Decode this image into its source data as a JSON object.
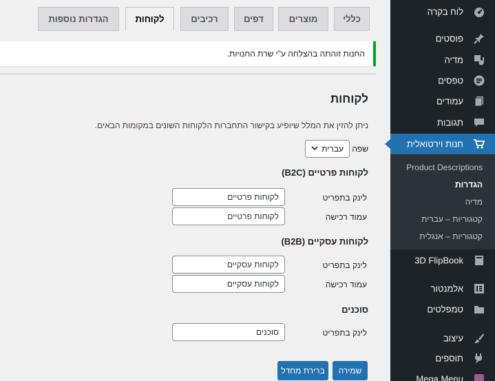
{
  "sidebar": {
    "items": [
      {
        "label": "לוח בקרה",
        "icon": "dashboard-icon"
      },
      {
        "label": "פוסטים",
        "icon": "pin-icon"
      },
      {
        "label": "מדיה",
        "icon": "media-icon"
      },
      {
        "label": "טפסים",
        "icon": "forms-icon"
      },
      {
        "label": "עמודים",
        "icon": "pages-icon"
      },
      {
        "label": "תגובות",
        "icon": "comments-icon"
      },
      {
        "label": "חנות וירטואלית",
        "icon": "cart-icon"
      },
      {
        "label": "3D FlipBook",
        "icon": "book-icon"
      },
      {
        "label": "אלמנטור",
        "icon": "elementor-icon"
      },
      {
        "label": "טמפלטים",
        "icon": "folder-icon"
      },
      {
        "label": "עיצוב",
        "icon": "brush-icon"
      },
      {
        "label": "תוספים",
        "icon": "plugin-icon"
      },
      {
        "label": "Mega Menu",
        "icon": "megamenu-icon"
      }
    ],
    "submenu": [
      "Product Descriptions",
      "הגדרות",
      "מדיה",
      "קטגוריות – עברית",
      "קטגוריות – אנגלית"
    ]
  },
  "tabs": [
    "כללי",
    "מוצרים",
    "דפים",
    "רכיבים",
    "לקוחות",
    "הגדרות נוספות"
  ],
  "notice": "החנות זוהתה בהצלחה ע\"י שרת החנויות.",
  "page": {
    "title": "לקוחות",
    "description": "ניתן להזין את המלל שיופיע בקישור התחברות הלקוחות השונים במקומות הבאים.",
    "language_label": "שפה",
    "language_value": "עברית"
  },
  "sections": {
    "b2c": {
      "title": "לקוחות פרטיים (B2C)",
      "link_label": "לינק בתפריט",
      "link_value": "לקוחות פרטיים",
      "page_label": "עמוד רכישה",
      "page_value": "לקוחות פרטיים"
    },
    "b2b": {
      "title": "לקוחות עסקיים (B2B)",
      "link_label": "לינק בתפריט",
      "link_value": "לקוחות עסקיים",
      "page_label": "עמוד רכישה",
      "page_value": "לקוחות עסקיים"
    },
    "agents": {
      "title": "סוכנים",
      "link_label": "לינק בתפריט",
      "link_value": "סוכנים"
    }
  },
  "buttons": {
    "save": "שמירה",
    "reset": "ברירת מחדל"
  },
  "colors": {
    "sidebar_bg": "#1d2327",
    "accent": "#2271b1",
    "notice_border": "#00a32a"
  }
}
